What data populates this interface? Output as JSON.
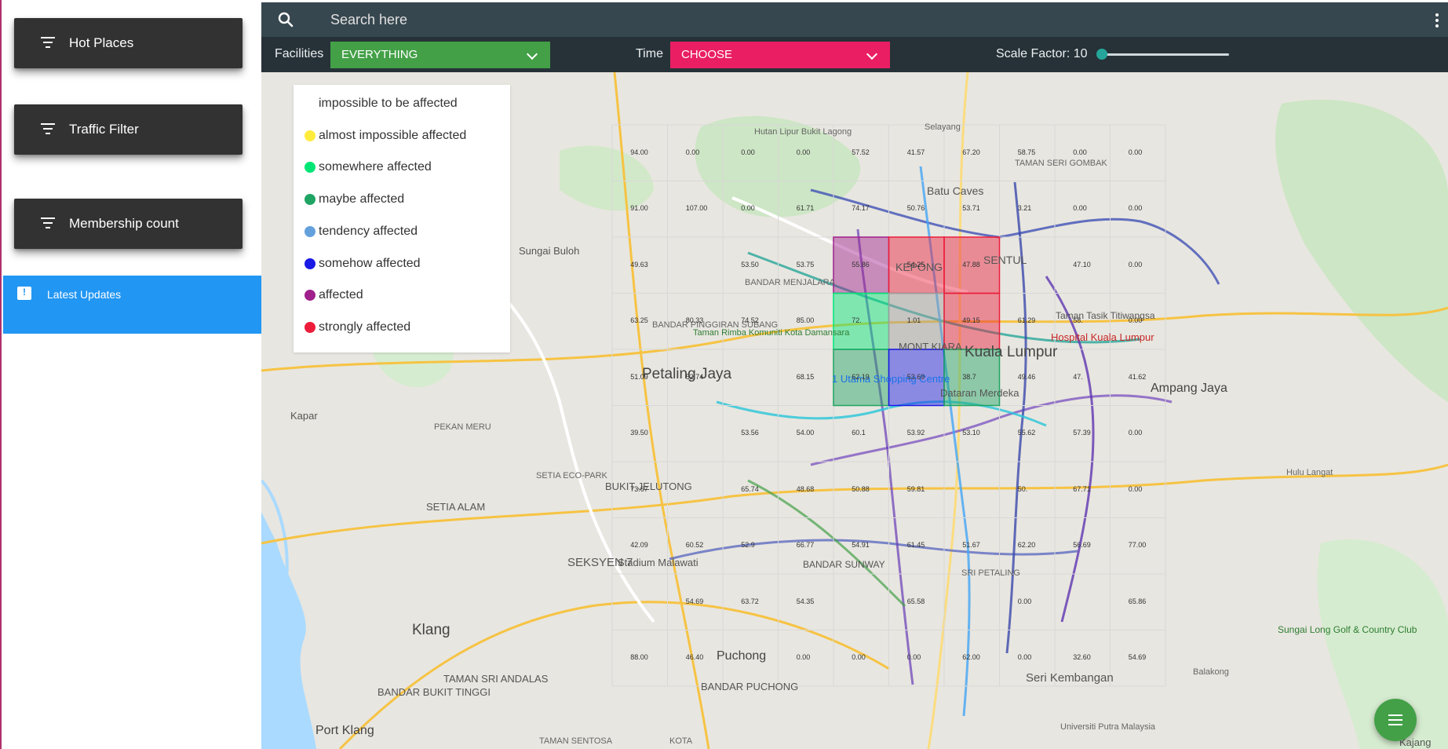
{
  "sidebar": {
    "buttons": [
      {
        "label": "Hot Places",
        "icon": "filter-list-icon"
      },
      {
        "label": "Traffic Filter",
        "icon": "filter-list-icon"
      },
      {
        "label": "Membership count",
        "icon": "filter-list-icon"
      }
    ],
    "latest": {
      "label": "Latest Updates",
      "icon": "announcement-icon",
      "color": "#2196f3"
    }
  },
  "search": {
    "placeholder": "Search here",
    "icon": "search-icon",
    "more_icon": "more-vert-icon"
  },
  "toolbar": {
    "facilities_label": "Facilities",
    "facilities_value": "EVERYTHING",
    "facilities_color": "#43a047",
    "time_label": "Time",
    "time_value": "CHOOSE",
    "time_color": "#e91e63",
    "scale_label": "Scale Factor: 10",
    "scale_value": 10
  },
  "legend": [
    {
      "label": "impossible to be affected",
      "color": "#ffffff"
    },
    {
      "label": "almost impossible affected",
      "color": "#ffeb3b"
    },
    {
      "label": "somewhere affected",
      "color": "#00e676"
    },
    {
      "label": "maybe affected",
      "color": "#1fa463"
    },
    {
      "label": "tendency affected",
      "color": "#64a0dc"
    },
    {
      "label": "somehow affected",
      "color": "#1a1ae6"
    },
    {
      "label": "affected",
      "color": "#a0208c"
    },
    {
      "label": "strongly affected",
      "color": "#ec1c3a"
    }
  ],
  "map": {
    "places": [
      "Petaling Jaya",
      "Kuala Lumpur",
      "Klang",
      "Ampang Jaya",
      "Puchong",
      "Port Klang",
      "Seri Kembangan",
      "SEKSYEN 7",
      "SETIA ALAM",
      "BUKIT JELUTONG",
      "Sungai Buloh",
      "Batu Caves",
      "TAMAN SERI GOMBAK",
      "KEPONG",
      "SENTUL",
      "MONT KIARA",
      "Kapar",
      "Hulu Langat",
      "BANDAR PUCHONG",
      "TAMAN SRI ANDALAS",
      "BANDAR BUKIT TINGGI",
      "Stadium Malawati",
      "Hospital Kuala Lumpur",
      "Dataran Merdeka",
      "1 Utama Shopping Centre",
      "Taman Tasik Titiwangsa",
      "Sungai Long Golf & Country Club",
      "BANDAR SUNWAY",
      "SRI PETALING",
      "Kajang",
      "TAMAN SENTOSA",
      "KOTA",
      "Universiti Putra Malaysia",
      "Hutan Lipur Bukit Lagong",
      "Selayang",
      "BANDAR MENJALARA",
      "BANDAR PINGGIRAN SUBANG",
      "Taman Rimba Komuniti Kota Damansara",
      "SETIA ECO-PARK",
      "PEKAN MERU",
      "Balakong"
    ],
    "grid_values": [
      [
        "94.00",
        "0.00",
        "0.00",
        "0.00",
        "57.52",
        "41.57",
        "67.20",
        "58.75",
        "0.00",
        "0.00"
      ],
      [
        "91.00",
        "107.00",
        "0.00",
        "61.71",
        "74.17",
        "50.76",
        "53.71",
        "3.21",
        "0.00",
        "0.00"
      ],
      [
        "49.63",
        "",
        "53.50",
        "53.75",
        "55.86",
        "54.25",
        "47.88",
        "",
        "47.10",
        "0.00"
      ],
      [
        "63.25",
        "80.33",
        "74.52",
        "85.00",
        "72.",
        "1.01",
        "49.15",
        "61.29",
        "58.",
        "0.00"
      ],
      [
        "51.09",
        "52.74",
        "",
        "68.15",
        "62.19",
        "53.69",
        "38.7",
        "49.46",
        "47.",
        "41.62"
      ],
      [
        "39.50",
        "",
        "53.56",
        "54.00",
        "60.1",
        "53.92",
        "53.10",
        "55.62",
        "57.39",
        "0.00"
      ],
      [
        "73.67",
        "",
        "65.74",
        "48.68",
        "50.88",
        "59.81",
        "",
        "50.",
        "67.71",
        "0.00"
      ],
      [
        "42.09",
        "60.52",
        "52.9",
        "66.77",
        "54.91",
        "61.45",
        "51.67",
        "62.20",
        "56.69",
        "77.00"
      ],
      [
        "",
        "54.69",
        "63.72",
        "54.35",
        "",
        "65.58",
        "",
        "0.00",
        "",
        "65.86"
      ],
      [
        "88.00",
        "46.40",
        "",
        "0.00",
        "0.00",
        "0.00",
        "62.00",
        "0.00",
        "32.60",
        "54.69"
      ]
    ],
    "heat_cells": [
      {
        "row": 2,
        "col": 4,
        "color": "#a0208c"
      },
      {
        "row": 2,
        "col": 5,
        "color": "#ec1c3a"
      },
      {
        "row": 2,
        "col": 6,
        "color": "#ec1c3a"
      },
      {
        "row": 3,
        "col": 4,
        "color": "#00e676"
      },
      {
        "row": 3,
        "col": 5,
        "color": "#9e9e9e"
      },
      {
        "row": 3,
        "col": 6,
        "color": "#ec1c3a"
      },
      {
        "row": 4,
        "col": 4,
        "color": "#1fa463"
      },
      {
        "row": 4,
        "col": 5,
        "color": "#1a1ae6"
      },
      {
        "row": 4,
        "col": 6,
        "color": "#1fa463"
      }
    ]
  },
  "fab": {
    "icon": "menu-icon",
    "color": "#43a047"
  }
}
